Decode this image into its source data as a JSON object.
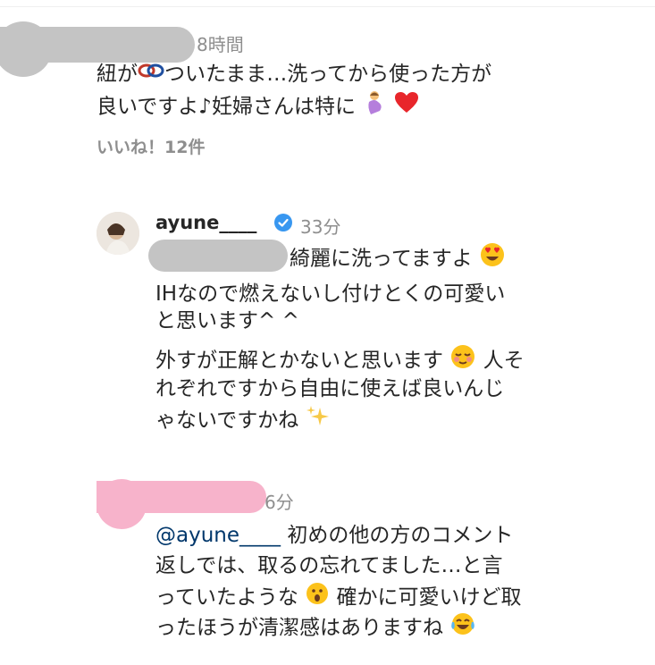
{
  "comment1": {
    "time": "8時間",
    "line1_a": "紐が",
    "line1_b": "ついたまま…洗ってから使った方が",
    "line2_a": "良いですよ♪妊婦さんは特に",
    "likes": "いいね！12件"
  },
  "reply1": {
    "username": "ayune____",
    "time": "33分",
    "line1": "綺麗に洗ってますよ",
    "line2": "IHなので燃えないし付けとくの可愛い",
    "line3": "と思います^ ^",
    "line4_a": "外すが正解とかないと思います",
    "line4_b": "人そ",
    "line5": "れぞれですから自由に使えば良いんじ",
    "line6": "ゃないですかね"
  },
  "reply2": {
    "time": "6分",
    "mention": "@ayune____",
    "line1_rest": " 初めの他の方のコメント",
    "line2": "返しでは、取るの忘れてました…と言",
    "line3_a": "っていたような",
    "line3_b": "確かに可愛いけど取",
    "line4": "ったほうが清潔感はありますね"
  },
  "colors": {
    "verified": "#3897f0",
    "heart": "#e8262b",
    "redaction_gray": "#c4c4c4",
    "redaction_pink": "#f7b3cb"
  }
}
